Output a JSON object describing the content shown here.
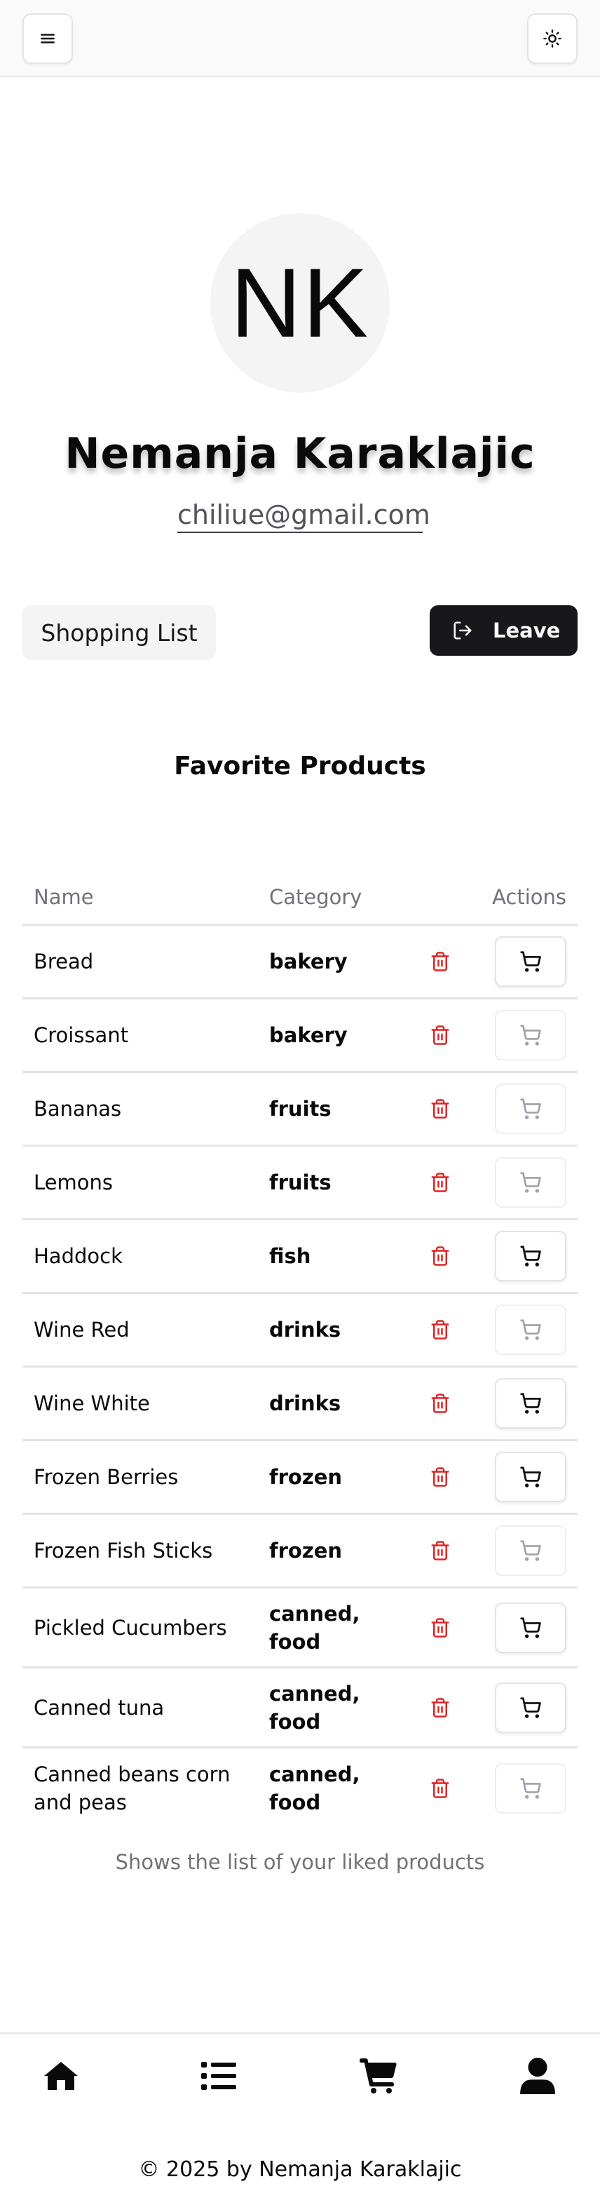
{
  "header": {
    "menu_icon": "hamburger-icon",
    "theme_icon": "sun-icon"
  },
  "profile": {
    "initials": "NK",
    "name": "Nemanja Karaklajic",
    "email": "chiliue@gmail.com"
  },
  "actions": {
    "shopping_list_label": "Shopping List",
    "leave_label": "Leave",
    "leave_icon": "log-out-icon"
  },
  "favorites": {
    "title": "Favorite Products",
    "columns": [
      "Name",
      "Category",
      "Actions"
    ],
    "rows": [
      {
        "name": "Bread",
        "category": "bakery",
        "in_cart": true
      },
      {
        "name": "Croissant",
        "category": "bakery",
        "in_cart": false
      },
      {
        "name": "Bananas",
        "category": "fruits",
        "in_cart": false
      },
      {
        "name": "Lemons",
        "category": "fruits",
        "in_cart": false
      },
      {
        "name": "Haddock",
        "category": "fish",
        "in_cart": true
      },
      {
        "name": "Wine Red",
        "category": "drinks",
        "in_cart": false
      },
      {
        "name": "Wine White",
        "category": "drinks",
        "in_cart": true
      },
      {
        "name": "Frozen Berries",
        "category": "frozen",
        "in_cart": true
      },
      {
        "name": "Frozen Fish Sticks",
        "category": "frozen",
        "in_cart": false
      },
      {
        "name": "Pickled Cucumbers",
        "category": "canned, food",
        "in_cart": true
      },
      {
        "name": "Canned tuna",
        "category": "canned, food",
        "in_cart": true
      },
      {
        "name": "Canned beans corn and peas",
        "category": "canned, food",
        "in_cart": false
      }
    ],
    "caption": "Shows the list of your liked products"
  },
  "bottom_nav": {
    "items": [
      {
        "icon": "home-icon"
      },
      {
        "icon": "list-icon"
      },
      {
        "icon": "cart-icon"
      },
      {
        "icon": "user-icon"
      }
    ]
  },
  "footer": {
    "text": "© 2025 by Nemanja Karaklajic"
  },
  "colors": {
    "accent_dark": "#18181b",
    "destructive": "#dc2626",
    "muted_text": "#71717a",
    "border": "#e4e4e7"
  }
}
